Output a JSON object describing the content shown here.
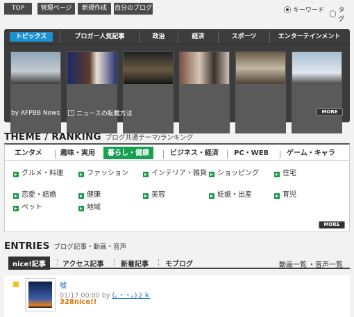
{
  "topbar": {
    "buttons": [
      "TOP",
      "管理ページ",
      "新規作成",
      "自分のブログ"
    ],
    "search_options": [
      {
        "label": "キーワード",
        "selected": true
      },
      {
        "label": "タグ",
        "selected": false
      }
    ]
  },
  "topics": {
    "tabs": [
      "トピックス",
      "ブロガー人気記事",
      "政治",
      "経済",
      "スポーツ",
      "エンターテインメント"
    ],
    "active_tab": "トピックス",
    "source": "by AFPBB News",
    "howto_icon": "?",
    "howto_label": "ニュースの転載方法",
    "more_label": "MORE"
  },
  "theme": {
    "heading": "THEME / RANKING",
    "subheading": "ブログ共通テーマ/ランキング",
    "categories": [
      "エンタメ",
      "趣味・実用",
      "暮らし・健康",
      "ビジネス・経済",
      "PC・WEB",
      "ゲーム・キャラ"
    ],
    "active_category": "暮らし・健康",
    "items": [
      "グルメ・料理",
      "ファッション",
      "インテリア・雑貨",
      "ショッピング",
      "住宅",
      "恋愛・結婚",
      "健康",
      "美容",
      "妊娠・出産",
      "育児",
      "ペット",
      "地域"
    ],
    "more_label": "MORE",
    "accent": "#18a150"
  },
  "entries": {
    "heading": "ENTRIES",
    "subheading": "ブログ記事・動画・音声",
    "tabs": [
      "nice!記事",
      "アクセス記事",
      "新着記事",
      "モブログ"
    ],
    "active_tab": "nice!記事",
    "links": [
      "動画一覧",
      "音声一覧"
    ],
    "link_separator": "・",
    "list": [
      {
        "title": "嘘",
        "date": "01/17",
        "time": "00:00",
        "by": "by",
        "user": "(。・・。)２ｋ",
        "nice": "328nice!!"
      }
    ]
  }
}
